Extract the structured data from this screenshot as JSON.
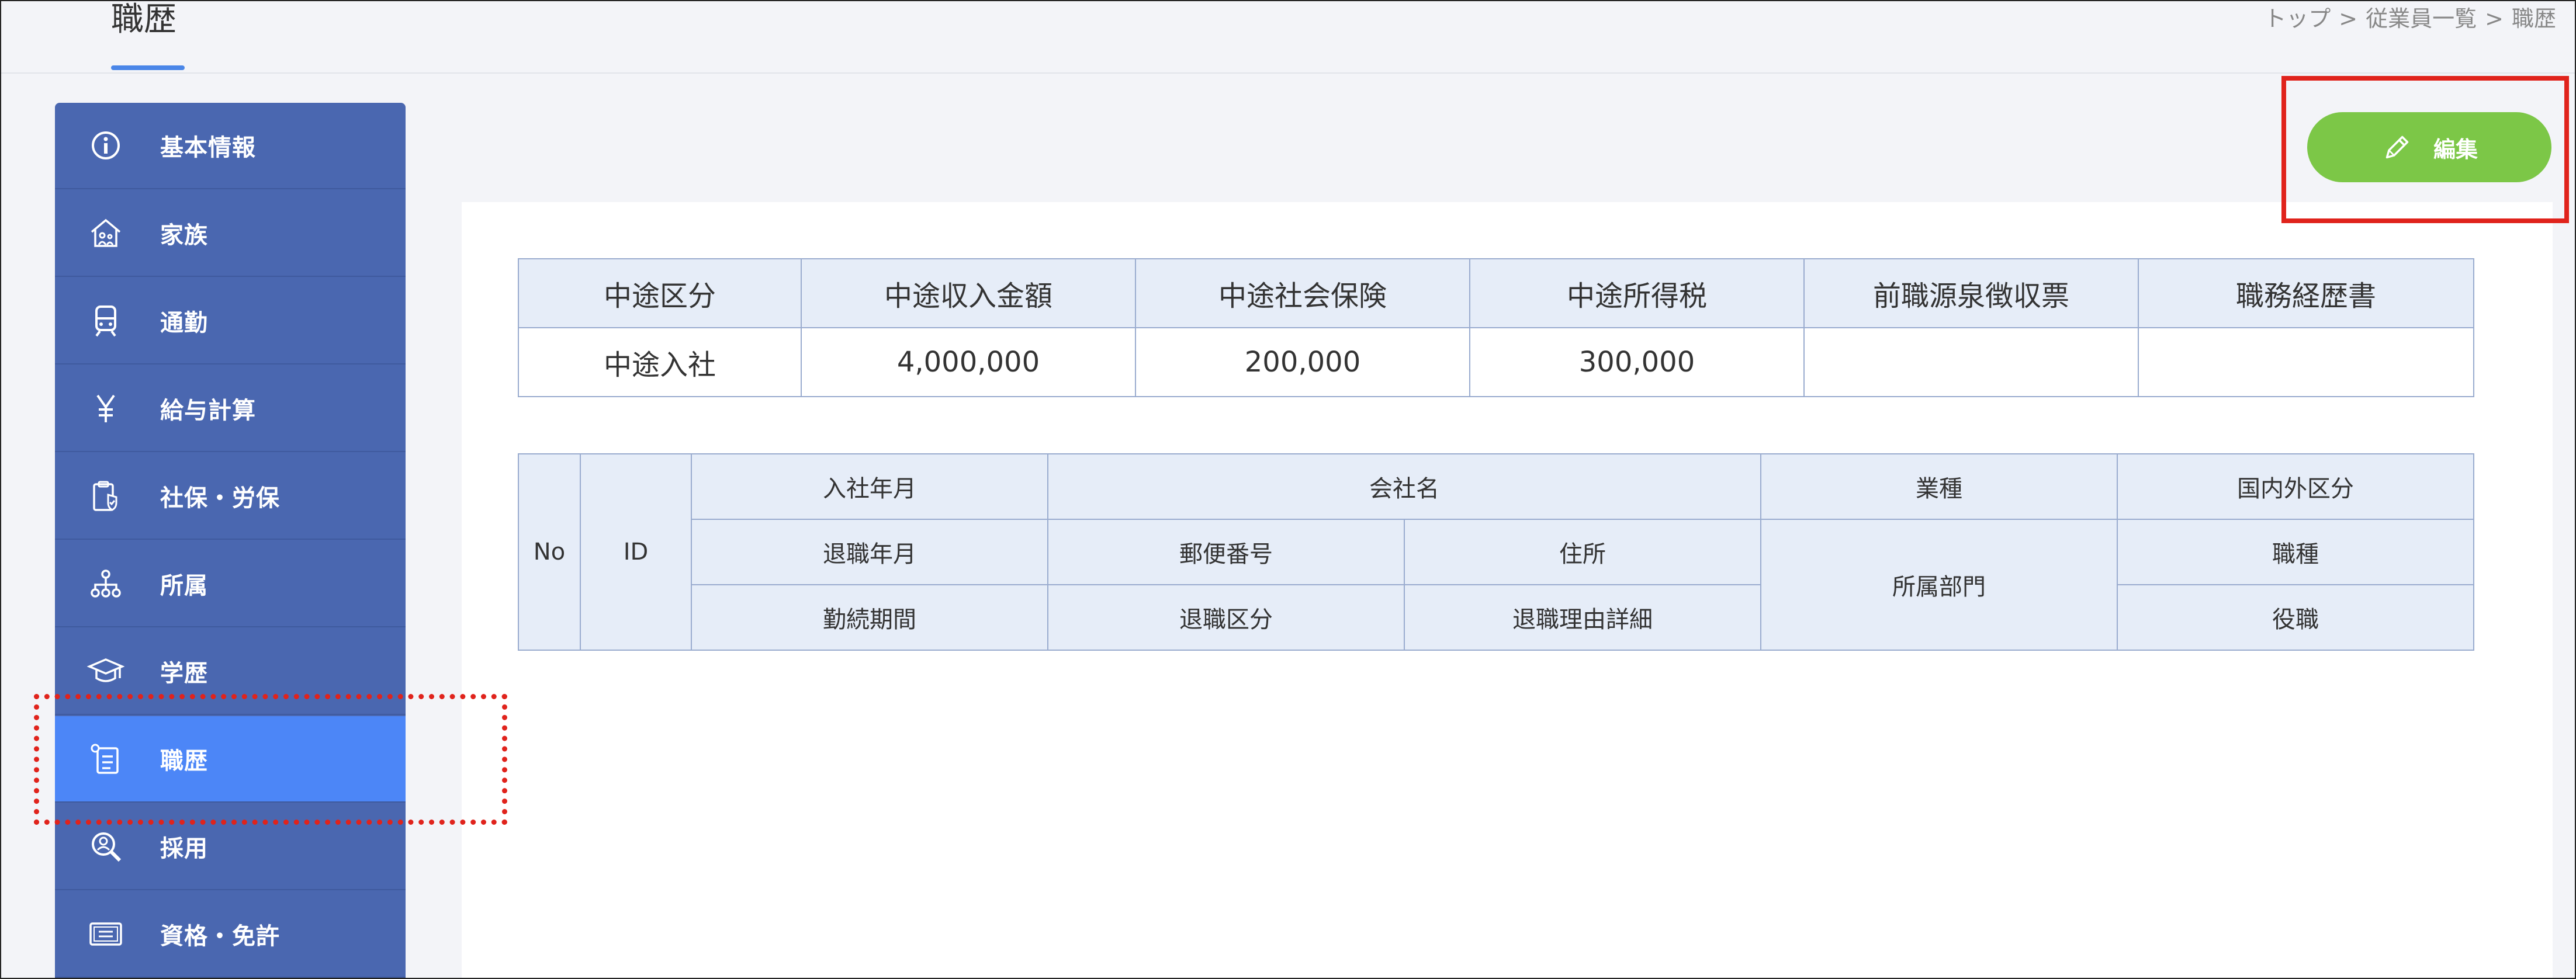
{
  "header": {
    "title": "職歴"
  },
  "breadcrumb": {
    "items": [
      "トップ",
      "従業員一覧",
      "職歴"
    ],
    "separator": ">"
  },
  "sidebar": {
    "items": [
      {
        "label": "基本情報",
        "icon": "info-icon"
      },
      {
        "label": "家族",
        "icon": "family-house-icon"
      },
      {
        "label": "通勤",
        "icon": "train-icon"
      },
      {
        "label": "給与計算",
        "icon": "yen-icon"
      },
      {
        "label": "社保・労保",
        "icon": "insurance-clipboard-icon"
      },
      {
        "label": "所属",
        "icon": "org-chart-icon"
      },
      {
        "label": "学歴",
        "icon": "graduation-cap-icon"
      },
      {
        "label": "職歴",
        "icon": "career-document-icon",
        "active": true
      },
      {
        "label": "採用",
        "icon": "recruit-search-icon"
      },
      {
        "label": "資格・免許",
        "icon": "certificate-icon"
      }
    ]
  },
  "actions": {
    "edit_label": "編集",
    "edit_icon": "pencil-icon",
    "edit_color": "#7cc747"
  },
  "mid_career_table": {
    "headers": [
      "中途区分",
      "中途収入金額",
      "中途社会保険",
      "中途所得税",
      "前職源泉徴収票",
      "職務経歴書"
    ],
    "row": [
      "中途入社",
      "4,000,000",
      "200,000",
      "300,000",
      "",
      ""
    ]
  },
  "history_table": {
    "no": "No",
    "id": "ID",
    "join_date": "入社年月",
    "company": "会社名",
    "industry": "業種",
    "domestic": "国内外区分",
    "leave_date": "退職年月",
    "postal": "郵便番号",
    "address": "住所",
    "department": "所属部門",
    "job_type": "職種",
    "tenure": "勤続期間",
    "leave_type": "退職区分",
    "leave_reason": "退職理由詳細",
    "position": "役職"
  },
  "colors": {
    "sidebar": "#4a67b0",
    "active": "#4c86f7",
    "highlight": "#e0231c",
    "header_cell": "#e6edf8"
  }
}
